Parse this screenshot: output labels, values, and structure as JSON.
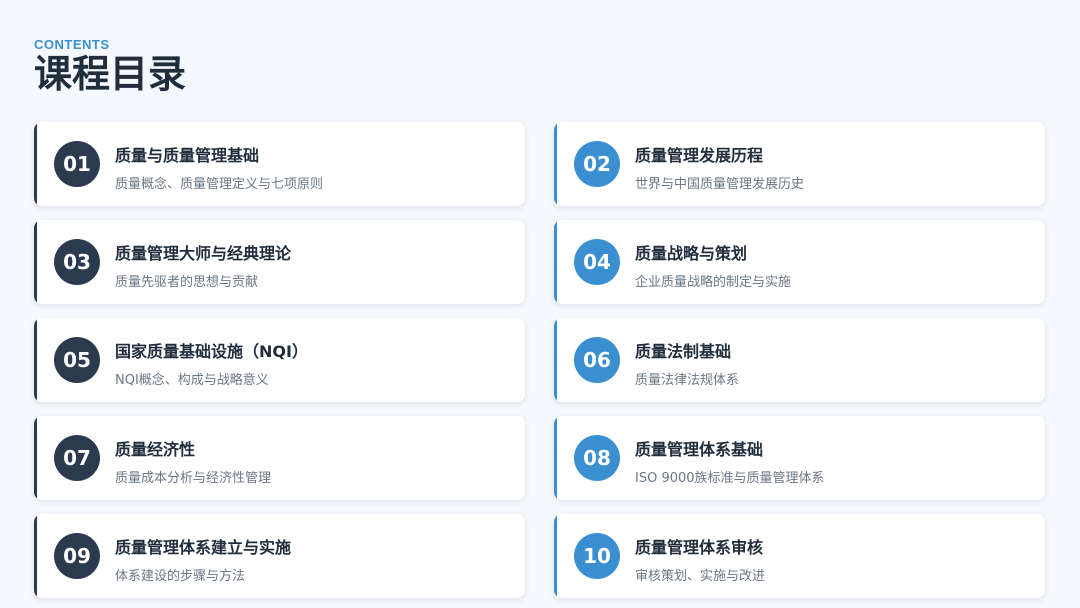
{
  "header": {
    "eyebrow": "CONTENTS",
    "title": "课程目录"
  },
  "colors": {
    "dark": "#2b3a4e",
    "blue": "#3a8fd0",
    "title_text": "#1f2d3d",
    "sub_text": "#6b7785",
    "background": "#f5f8fc"
  },
  "items": [
    {
      "number": "01",
      "title": "质量与质量管理基础",
      "subtitle": "质量概念、质量管理定义与七项原则",
      "accent": "dark"
    },
    {
      "number": "02",
      "title": "质量管理发展历程",
      "subtitle": "世界与中国质量管理发展历史",
      "accent": "blue"
    },
    {
      "number": "03",
      "title": "质量管理大师与经典理论",
      "subtitle": "质量先驱者的思想与贡献",
      "accent": "dark"
    },
    {
      "number": "04",
      "title": "质量战略与策划",
      "subtitle": "企业质量战略的制定与实施",
      "accent": "blue"
    },
    {
      "number": "05",
      "title": "国家质量基础设施（NQI）",
      "subtitle": "NQI概念、构成与战略意义",
      "accent": "dark"
    },
    {
      "number": "06",
      "title": "质量法制基础",
      "subtitle": "质量法律法规体系",
      "accent": "blue"
    },
    {
      "number": "07",
      "title": "质量经济性",
      "subtitle": "质量成本分析与经济性管理",
      "accent": "dark"
    },
    {
      "number": "08",
      "title": "质量管理体系基础",
      "subtitle": "ISO 9000族标准与质量管理体系",
      "accent": "blue"
    },
    {
      "number": "09",
      "title": "质量管理体系建立与实施",
      "subtitle": "体系建设的步骤与方法",
      "accent": "dark"
    },
    {
      "number": "10",
      "title": "质量管理体系审核",
      "subtitle": "审核策划、实施与改进",
      "accent": "blue"
    }
  ]
}
